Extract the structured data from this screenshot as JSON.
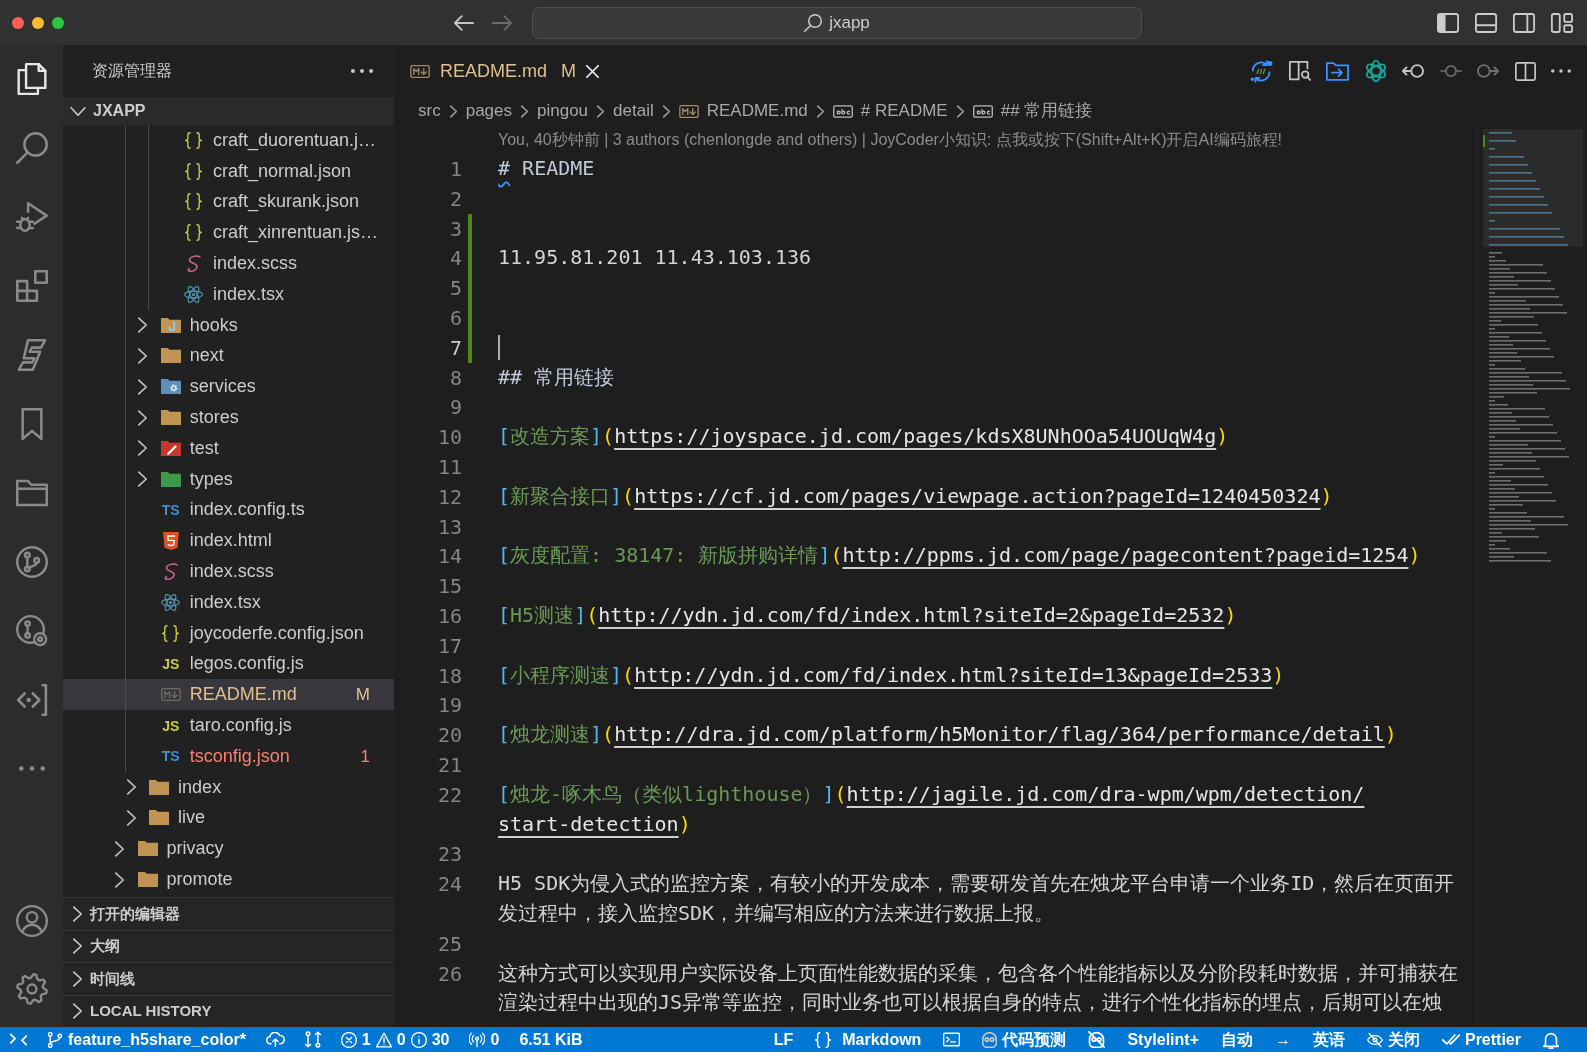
{
  "window": {
    "command_center": "jxapp"
  },
  "activity_bar": {
    "top": [
      {
        "kind": "explorer",
        "selected": true
      },
      {
        "kind": "search",
        "selected": false
      },
      {
        "kind": "debug",
        "selected": false
      },
      {
        "kind": "extensions",
        "selected": false
      },
      {
        "kind": "assistant",
        "selected": false
      },
      {
        "kind": "bookmarks",
        "selected": false
      },
      {
        "kind": "projects",
        "selected": false
      },
      {
        "kind": "git_graph",
        "selected": false
      },
      {
        "kind": "git_history",
        "selected": false
      },
      {
        "kind": "remote",
        "selected": false
      },
      {
        "kind": "more",
        "selected": false
      }
    ],
    "bottom": [
      {
        "kind": "account"
      },
      {
        "kind": "settings"
      }
    ]
  },
  "sidebar": {
    "title": "资源管理器",
    "root": {
      "title": "JXAPP",
      "expanded": true
    },
    "tree": [
      {
        "children": [
          {
            "children": [
              {
                "children": [
                  {
                    "children": [
                      {
                        "label": "craft_duorentuan.j…",
                        "kind": "json",
                        "selected": false
                      },
                      {
                        "label": "craft_normal.json",
                        "kind": "json",
                        "selected": false
                      },
                      {
                        "label": "craft_skurank.json",
                        "kind": "json",
                        "selected": false
                      },
                      {
                        "label": "craft_xinrentuan.js…",
                        "kind": "json",
                        "selected": false
                      },
                      {
                        "label": "index.scss",
                        "kind": "scss",
                        "selected": false
                      },
                      {
                        "label": "index.tsx",
                        "kind": "react",
                        "selected": false
                      }
                    ]
                  }
                ]
              },
              {
                "label": "hooks",
                "kind": "hooks_folder",
                "expanded": false,
                "selected": false
              },
              {
                "label": "next",
                "kind": "folder",
                "expanded": false,
                "selected": false
              },
              {
                "label": "services",
                "kind": "services_folder",
                "expanded": false,
                "selected": false
              },
              {
                "label": "stores",
                "kind": "folder",
                "expanded": false,
                "selected": false
              },
              {
                "label": "test",
                "kind": "test_folder",
                "expanded": false,
                "selected": false
              },
              {
                "label": "types",
                "kind": "types_folder",
                "expanded": false,
                "selected": false
              },
              {
                "label": "index.config.ts",
                "kind": "ts",
                "glyph": "TS",
                "selected": false
              },
              {
                "label": "index.html",
                "kind": "html",
                "selected": false
              },
              {
                "label": "index.scss",
                "kind": "scss",
                "selected": false
              },
              {
                "label": "index.tsx",
                "kind": "react",
                "selected": false
              },
              {
                "label": "joycoderfe.config.json",
                "kind": "json",
                "selected": false
              },
              {
                "label": "legos.config.js",
                "kind": "js",
                "glyph": "JS",
                "selected": false
              },
              {
                "label": "README.md",
                "kind": "markdown",
                "selected": true,
                "color": "#e2c08d",
                "badge": "M"
              },
              {
                "label": "taro.config.js",
                "kind": "js",
                "glyph": "JS",
                "selected": false
              },
              {
                "label": "tsconfig.json",
                "kind": "tsconfig",
                "glyph": "TS",
                "selected": false,
                "color": "#f88070",
                "badge": "1"
              }
            ]
          },
          {
            "label": "index",
            "kind": "folder",
            "expanded": false,
            "selected": false
          },
          {
            "label": "live",
            "kind": "folder",
            "expanded": false,
            "selected": false
          }
        ]
      },
      {
        "label": "privacy",
        "kind": "folder",
        "expanded": false,
        "selected": false
      },
      {
        "label": "promote",
        "kind": "folder",
        "expanded": false,
        "selected": false
      }
    ],
    "sections": [
      {
        "title": "打开的编辑器",
        "expanded": false
      },
      {
        "title": "大纲",
        "expanded": false
      },
      {
        "title": "时间线",
        "expanded": false
      },
      {
        "title": "LOCAL HISTORY",
        "expanded": false
      }
    ]
  },
  "editor": {
    "tabs": [
      {
        "title": "README.md",
        "badge": "M",
        "color": "#e2c08d",
        "selected": true
      }
    ],
    "breadcrumbs": [
      {
        "kind": "folder",
        "text": "src"
      },
      {
        "kind": "folder",
        "text": "pages"
      },
      {
        "kind": "folder",
        "text": "pingou"
      },
      {
        "kind": "folder",
        "text": "detail"
      },
      {
        "kind": "file",
        "text": "README.md"
      },
      {
        "kind": "symbol",
        "text": "# README"
      },
      {
        "kind": "symbol",
        "text": "## 常用链接"
      }
    ],
    "codelens": "You, 40秒钟前 | 3 authors (chenlongde and others) | JoyCoder小知识: 点我或按下(Shift+Alt+K)开启AI编码旅程!",
    "lines": [
      {
        "number": "1",
        "added": false,
        "current": false,
        "tokens": [
          {
            "kind": "heading",
            "text": "#",
            "squiggle": true
          },
          {
            "kind": "heading",
            "text": " README"
          }
        ]
      },
      {
        "number": "2",
        "added": false,
        "current": false
      },
      {
        "number": "3",
        "added": true,
        "current": false
      },
      {
        "number": "4",
        "added": true,
        "current": false,
        "tokens": [
          {
            "kind": "text",
            "text": "11.95.81.201 11.43.103.136"
          }
        ]
      },
      {
        "number": "5",
        "added": true,
        "current": false
      },
      {
        "number": "6",
        "added": true,
        "current": false
      },
      {
        "number": "7",
        "added": true,
        "current": true
      },
      {
        "number": "8",
        "added": false,
        "current": false,
        "tokens": [
          {
            "kind": "heading",
            "text": "## 常用链接"
          }
        ]
      },
      {
        "number": "9",
        "added": false,
        "current": false
      },
      {
        "number": "10",
        "added": false,
        "current": false,
        "tokens": [
          {
            "kind": "bracket",
            "text": "["
          },
          {
            "kind": "label",
            "text": "改造方案"
          },
          {
            "kind": "bracket",
            "text": "]"
          },
          {
            "kind": "paren",
            "text": "("
          },
          {
            "kind": "url",
            "text": "https://joyspace.jd.com/pages/kdsX8UNhOOa54UOUqW4g"
          },
          {
            "kind": "paren",
            "text": ")"
          }
        ]
      },
      {
        "number": "11",
        "added": false,
        "current": false
      },
      {
        "number": "12",
        "added": false,
        "current": false,
        "tokens": [
          {
            "kind": "bracket",
            "text": "["
          },
          {
            "kind": "label",
            "text": "新聚合接口"
          },
          {
            "kind": "bracket",
            "text": "]"
          },
          {
            "kind": "paren",
            "text": "("
          },
          {
            "kind": "url",
            "text": "https://cf.jd.com/pages/viewpage.action?pageId=1240450324"
          },
          {
            "kind": "paren",
            "text": ")"
          }
        ]
      },
      {
        "number": "13",
        "added": false,
        "current": false
      },
      {
        "number": "14",
        "added": false,
        "current": false,
        "tokens": [
          {
            "kind": "bracket",
            "text": "["
          },
          {
            "kind": "label",
            "text": "灰度配置: 38147: 新版拼购详情"
          },
          {
            "kind": "bracket",
            "text": "]"
          },
          {
            "kind": "paren",
            "text": "("
          },
          {
            "kind": "url",
            "text": "http://ppms.jd.com/page/pagecontent?pageid=1254"
          },
          {
            "kind": "paren",
            "text": ")"
          }
        ]
      },
      {
        "number": "15",
        "added": false,
        "current": false
      },
      {
        "number": "16",
        "added": false,
        "current": false,
        "tokens": [
          {
            "kind": "bracket",
            "text": "["
          },
          {
            "kind": "label",
            "text": "H5测速"
          },
          {
            "kind": "bracket",
            "text": "]"
          },
          {
            "kind": "paren",
            "text": "("
          },
          {
            "kind": "url",
            "text": "http://ydn.jd.com/fd/index.html?siteId=2&pageId=2532"
          },
          {
            "kind": "paren",
            "text": ")"
          }
        ]
      },
      {
        "number": "17",
        "added": false,
        "current": false
      },
      {
        "number": "18",
        "added": false,
        "current": false,
        "tokens": [
          {
            "kind": "bracket",
            "text": "["
          },
          {
            "kind": "label",
            "text": "小程序测速"
          },
          {
            "kind": "bracket",
            "text": "]"
          },
          {
            "kind": "paren",
            "text": "("
          },
          {
            "kind": "url",
            "text": "http://ydn.jd.com/fd/index.html?siteId=13&pageId=2533"
          },
          {
            "kind": "paren",
            "text": ")"
          }
        ]
      },
      {
        "number": "19",
        "added": false,
        "current": false
      },
      {
        "number": "20",
        "added": false,
        "current": false,
        "tokens": [
          {
            "kind": "bracket",
            "text": "["
          },
          {
            "kind": "label",
            "text": "烛龙测速"
          },
          {
            "kind": "bracket",
            "text": "]"
          },
          {
            "kind": "paren",
            "text": "("
          },
          {
            "kind": "url",
            "text": "http://dra.jd.com/platform/h5Monitor/flag/364/performance/detail"
          },
          {
            "kind": "paren",
            "text": ")"
          }
        ]
      },
      {
        "number": "21",
        "added": false,
        "current": false
      },
      {
        "number": "22",
        "added": false,
        "current": false,
        "tokens": [
          {
            "kind": "bracket",
            "text": "["
          },
          {
            "kind": "label",
            "text": "烛龙-啄木鸟（类似lighthouse）"
          },
          {
            "kind": "bracket",
            "text": "]"
          },
          {
            "kind": "paren",
            "text": "("
          },
          {
            "kind": "url",
            "text": "http://jagile.jd.com/dra-wpm/wpm/detection/"
          },
          {
            "kind": "wrap"
          },
          {
            "kind": "url",
            "text": "start-detection"
          },
          {
            "kind": "paren",
            "text": ")"
          }
        ]
      },
      {
        "number": "23",
        "added": false,
        "current": false
      },
      {
        "number": "24",
        "added": false,
        "current": false,
        "tokens": [
          {
            "kind": "text",
            "text": "H5 SDK为侵入式的监控方案，有较小的开发成本，需要研发首先在烛龙平台申请一个业务ID，然后在页面开"
          },
          {
            "kind": "wrap"
          },
          {
            "kind": "text",
            "text": "发过程中，接入监控SDK，并编写相应的方法来进行数据上报。"
          }
        ]
      },
      {
        "number": "25",
        "added": false,
        "current": false
      },
      {
        "number": "26",
        "added": false,
        "current": false,
        "tokens": [
          {
            "kind": "text",
            "text": "这种方式可以实现用户实际设备上页面性能数据的采集，包含各个性能指标以及分阶段耗时数据，并可捕获在"
          },
          {
            "kind": "wrap"
          },
          {
            "kind": "text",
            "text": "渲染过程中出现的JS异常等监控，同时业务也可以根据自身的特点，进行个性化指标的埋点，后期可以在烛"
          }
        ]
      }
    ]
  },
  "status_bar": {
    "left": [
      {
        "kind": "remote"
      },
      {
        "kind": "branch",
        "text": "feature_h5share_color*"
      },
      {
        "kind": "publish"
      },
      {
        "kind": "compare"
      },
      {
        "kind": "problems",
        "errors": "1",
        "warnings": "0",
        "infos": "30"
      },
      {
        "kind": "ports",
        "text": "0"
      },
      {
        "kind": "text",
        "text": "6.51 KiB"
      }
    ],
    "right": [
      {
        "kind": "text",
        "text": "LF"
      },
      {
        "kind": "language",
        "text": "Markdown"
      },
      {
        "kind": "terminal"
      },
      {
        "kind": "prediction",
        "text": "代码预测"
      },
      {
        "kind": "prediction_off"
      },
      {
        "kind": "text",
        "text": "Stylelint+"
      },
      {
        "kind": "text",
        "text": "自动"
      },
      {
        "kind": "text",
        "text": "→"
      },
      {
        "kind": "text",
        "text": "英语"
      },
      {
        "kind": "hidden",
        "text": "关闭"
      },
      {
        "kind": "prettier",
        "text": "Prettier"
      },
      {
        "kind": "bell"
      }
    ]
  }
}
